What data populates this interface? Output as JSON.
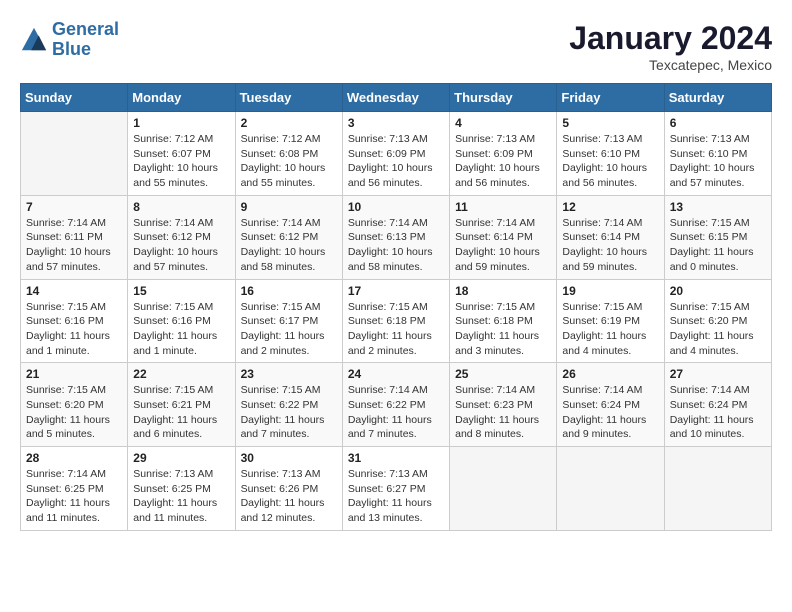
{
  "header": {
    "logo_line1": "General",
    "logo_line2": "Blue",
    "month": "January 2024",
    "location": "Texcatepec, Mexico"
  },
  "days_of_week": [
    "Sunday",
    "Monday",
    "Tuesday",
    "Wednesday",
    "Thursday",
    "Friday",
    "Saturday"
  ],
  "weeks": [
    [
      {
        "day": "",
        "info": ""
      },
      {
        "day": "1",
        "info": "Sunrise: 7:12 AM\nSunset: 6:07 PM\nDaylight: 10 hours\nand 55 minutes."
      },
      {
        "day": "2",
        "info": "Sunrise: 7:12 AM\nSunset: 6:08 PM\nDaylight: 10 hours\nand 55 minutes."
      },
      {
        "day": "3",
        "info": "Sunrise: 7:13 AM\nSunset: 6:09 PM\nDaylight: 10 hours\nand 56 minutes."
      },
      {
        "day": "4",
        "info": "Sunrise: 7:13 AM\nSunset: 6:09 PM\nDaylight: 10 hours\nand 56 minutes."
      },
      {
        "day": "5",
        "info": "Sunrise: 7:13 AM\nSunset: 6:10 PM\nDaylight: 10 hours\nand 56 minutes."
      },
      {
        "day": "6",
        "info": "Sunrise: 7:13 AM\nSunset: 6:10 PM\nDaylight: 10 hours\nand 57 minutes."
      }
    ],
    [
      {
        "day": "7",
        "info": "Sunrise: 7:14 AM\nSunset: 6:11 PM\nDaylight: 10 hours\nand 57 minutes."
      },
      {
        "day": "8",
        "info": "Sunrise: 7:14 AM\nSunset: 6:12 PM\nDaylight: 10 hours\nand 57 minutes."
      },
      {
        "day": "9",
        "info": "Sunrise: 7:14 AM\nSunset: 6:12 PM\nDaylight: 10 hours\nand 58 minutes."
      },
      {
        "day": "10",
        "info": "Sunrise: 7:14 AM\nSunset: 6:13 PM\nDaylight: 10 hours\nand 58 minutes."
      },
      {
        "day": "11",
        "info": "Sunrise: 7:14 AM\nSunset: 6:14 PM\nDaylight: 10 hours\nand 59 minutes."
      },
      {
        "day": "12",
        "info": "Sunrise: 7:14 AM\nSunset: 6:14 PM\nDaylight: 10 hours\nand 59 minutes."
      },
      {
        "day": "13",
        "info": "Sunrise: 7:15 AM\nSunset: 6:15 PM\nDaylight: 11 hours\nand 0 minutes."
      }
    ],
    [
      {
        "day": "14",
        "info": "Sunrise: 7:15 AM\nSunset: 6:16 PM\nDaylight: 11 hours\nand 1 minute."
      },
      {
        "day": "15",
        "info": "Sunrise: 7:15 AM\nSunset: 6:16 PM\nDaylight: 11 hours\nand 1 minute."
      },
      {
        "day": "16",
        "info": "Sunrise: 7:15 AM\nSunset: 6:17 PM\nDaylight: 11 hours\nand 2 minutes."
      },
      {
        "day": "17",
        "info": "Sunrise: 7:15 AM\nSunset: 6:18 PM\nDaylight: 11 hours\nand 2 minutes."
      },
      {
        "day": "18",
        "info": "Sunrise: 7:15 AM\nSunset: 6:18 PM\nDaylight: 11 hours\nand 3 minutes."
      },
      {
        "day": "19",
        "info": "Sunrise: 7:15 AM\nSunset: 6:19 PM\nDaylight: 11 hours\nand 4 minutes."
      },
      {
        "day": "20",
        "info": "Sunrise: 7:15 AM\nSunset: 6:20 PM\nDaylight: 11 hours\nand 4 minutes."
      }
    ],
    [
      {
        "day": "21",
        "info": "Sunrise: 7:15 AM\nSunset: 6:20 PM\nDaylight: 11 hours\nand 5 minutes."
      },
      {
        "day": "22",
        "info": "Sunrise: 7:15 AM\nSunset: 6:21 PM\nDaylight: 11 hours\nand 6 minutes."
      },
      {
        "day": "23",
        "info": "Sunrise: 7:15 AM\nSunset: 6:22 PM\nDaylight: 11 hours\nand 7 minutes."
      },
      {
        "day": "24",
        "info": "Sunrise: 7:14 AM\nSunset: 6:22 PM\nDaylight: 11 hours\nand 7 minutes."
      },
      {
        "day": "25",
        "info": "Sunrise: 7:14 AM\nSunset: 6:23 PM\nDaylight: 11 hours\nand 8 minutes."
      },
      {
        "day": "26",
        "info": "Sunrise: 7:14 AM\nSunset: 6:24 PM\nDaylight: 11 hours\nand 9 minutes."
      },
      {
        "day": "27",
        "info": "Sunrise: 7:14 AM\nSunset: 6:24 PM\nDaylight: 11 hours\nand 10 minutes."
      }
    ],
    [
      {
        "day": "28",
        "info": "Sunrise: 7:14 AM\nSunset: 6:25 PM\nDaylight: 11 hours\nand 11 minutes."
      },
      {
        "day": "29",
        "info": "Sunrise: 7:13 AM\nSunset: 6:25 PM\nDaylight: 11 hours\nand 11 minutes."
      },
      {
        "day": "30",
        "info": "Sunrise: 7:13 AM\nSunset: 6:26 PM\nDaylight: 11 hours\nand 12 minutes."
      },
      {
        "day": "31",
        "info": "Sunrise: 7:13 AM\nSunset: 6:27 PM\nDaylight: 11 hours\nand 13 minutes."
      },
      {
        "day": "",
        "info": ""
      },
      {
        "day": "",
        "info": ""
      },
      {
        "day": "",
        "info": ""
      }
    ]
  ]
}
